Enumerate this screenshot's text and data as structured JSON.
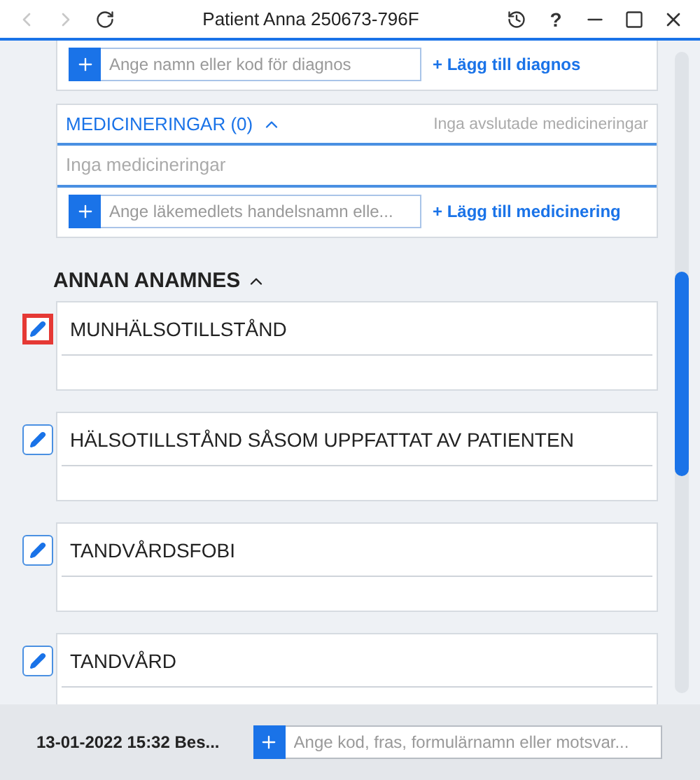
{
  "window": {
    "title": "Patient Anna 250673-796F",
    "help": "?"
  },
  "diagnosis": {
    "placeholder": "Ange namn eller kod för diagnos",
    "add_link": "+ Lägg till diagnos"
  },
  "medications": {
    "title": "MEDICINERINGAR (0)",
    "expanded": true,
    "ended_note": "Inga avslutade medicineringar",
    "empty_text": "Inga medicineringar",
    "placeholder": "Ange läkemedlets handelsnamn elle...",
    "add_link": "+ Lägg till medicinering"
  },
  "anamnesis": {
    "title": "ANNAN ANAMNES",
    "expanded": true,
    "items": [
      {
        "label": "MUNHÄLSOTILLSTÅND",
        "selected": true
      },
      {
        "label": "HÄLSOTILLSTÅND SÅSOM UPPFATTAT AV PATIENTEN",
        "selected": false
      },
      {
        "label": "TANDVÅRDSFOBI",
        "selected": false
      },
      {
        "label": "TANDVÅRD",
        "selected": false
      }
    ]
  },
  "footer": {
    "visit": "13-01-2022 15:32 Bes...",
    "placeholder": "Ange kod, fras, formulärnamn eller motsvar..."
  }
}
